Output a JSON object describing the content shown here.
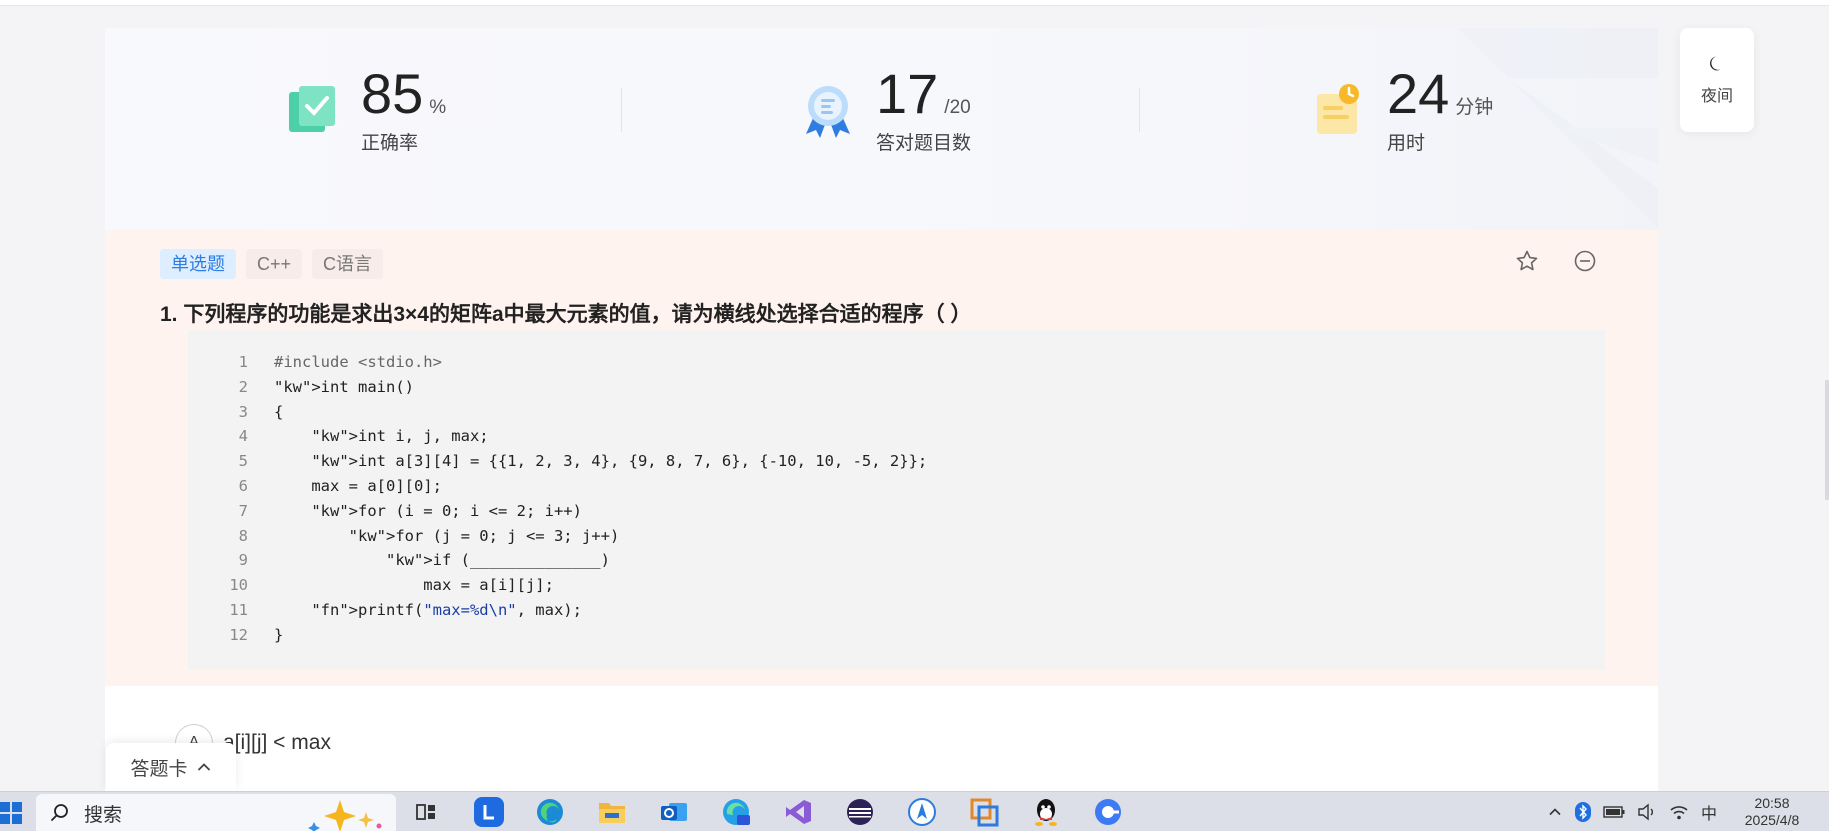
{
  "stats": [
    {
      "value": "85",
      "unit": "%",
      "label": "正确率"
    },
    {
      "value": "17",
      "unit": "/20",
      "label": "答对题目数"
    },
    {
      "value": "24",
      "unit": "分钟",
      "label": "用时"
    }
  ],
  "night_mode": {
    "label": "夜间"
  },
  "question": {
    "tags": [
      "单选题",
      "C++",
      "C语言"
    ],
    "title": "1. 下列程序的功能是求出3×4的矩阵a中最大元素的值，请为横线处选择合适的程序（  ）",
    "code_lines": [
      "#include <stdio.h>",
      "int main()",
      "{",
      "    int i, j, max;",
      "    int a[3][4] = {{1, 2, 3, 4}, {9, 8, 7, 6}, {-10, 10, -5, 2}};",
      "    max = a[0][0];",
      "    for (i = 0; i <= 2; i++)",
      "        for (j = 0; j <= 3; j++)",
      "            if (______________)",
      "                max = a[i][j];",
      "    printf(\"max=%d\\n\", max);",
      "}"
    ]
  },
  "options": [
    {
      "letter": "A",
      "text": "a[i][j] < max"
    }
  ],
  "answer_card": {
    "label": "答题卡"
  },
  "taskbar": {
    "search_placeholder": "搜索",
    "time": "20:58",
    "date": "2025/4/8",
    "ime": "中"
  },
  "colors": {
    "accent_blue": "#2f7de1",
    "question_bg": "#fff3ef",
    "keyword": "#1a3d8f",
    "function": "#d61c6d",
    "string": "#1a3ea8"
  }
}
